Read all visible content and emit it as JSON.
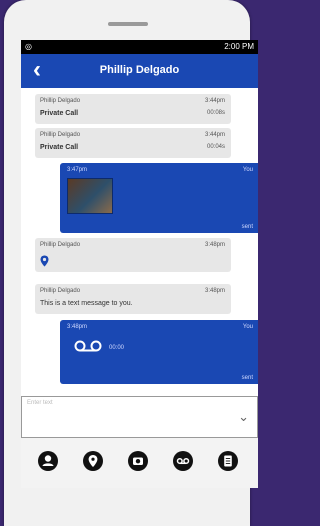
{
  "status_bar": {
    "left_icon": "camera-icon",
    "time": "2:00 PM"
  },
  "header": {
    "back_icon": "back-chevron-icon",
    "title": "Phillip Delgado"
  },
  "messages": [
    {
      "type": "call",
      "sender": "Phillip Delgado",
      "time": "3:44pm",
      "text": "Private Call",
      "duration": "00:08s"
    },
    {
      "type": "call",
      "sender": "Phillip Delgado",
      "time": "3:44pm",
      "text": "Private Call",
      "duration": "00:04s"
    },
    {
      "type": "image",
      "time": "3:47pm",
      "sender": "You",
      "status": "sent"
    },
    {
      "type": "location",
      "sender": "Phillip Delgado",
      "time": "3:48pm"
    },
    {
      "type": "text",
      "sender": "Phillip Delgado",
      "time": "3:48pm",
      "text": "This is a text message to you."
    },
    {
      "type": "voicemail",
      "time": "3:48pm",
      "sender": "You",
      "duration": "00:00",
      "status": "sent"
    }
  ],
  "composer": {
    "placeholder": "Enter text",
    "expand_icon": "double-chevron-down-icon"
  },
  "bottom_actions": [
    {
      "icon": "contact-icon"
    },
    {
      "icon": "location-pin-icon"
    },
    {
      "icon": "camera-icon"
    },
    {
      "icon": "voicemail-icon"
    },
    {
      "icon": "document-icon"
    }
  ],
  "colors": {
    "primary": "#1a48b3",
    "background": "#3b2870",
    "bubble_in": "#e7e7e7"
  }
}
